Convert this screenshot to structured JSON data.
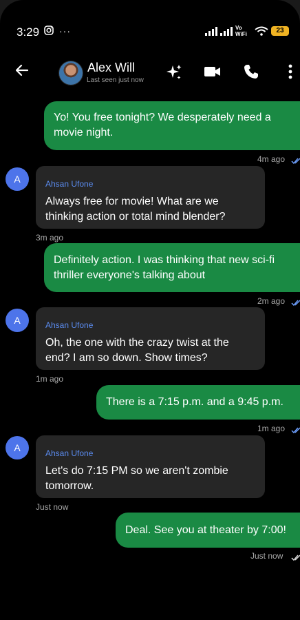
{
  "status_bar": {
    "time": "3:29",
    "network_label": "Vo\nWiFi",
    "battery": "23"
  },
  "header": {
    "contact_name": "Alex Will",
    "last_seen": "Last seen just now"
  },
  "messages": [
    {
      "direction": "outgoing",
      "text": "Yo! You free tonight? We desperately need a movie night.",
      "time": "4m ago"
    },
    {
      "direction": "incoming",
      "sender": "Ahsan Ufone",
      "avatar_letter": "A",
      "text": "Always free for movie! What are we thinking action or total mind blender?",
      "time": "3m ago"
    },
    {
      "direction": "outgoing",
      "text": "Definitely action. I was thinking that new sci-fi thriller everyone's talking about",
      "time": "2m ago"
    },
    {
      "direction": "incoming",
      "sender": "Ahsan Ufone",
      "avatar_letter": "A",
      "text": "Oh, the one with the crazy twist at the end? I am so down. Show times?",
      "time": "1m ago"
    },
    {
      "direction": "outgoing",
      "text": "There is a 7:15 p.m. and a 9:45 p.m.",
      "time": "1m ago"
    },
    {
      "direction": "incoming",
      "sender": "Ahsan Ufone",
      "avatar_letter": "A",
      "text": "Let's do 7:15 PM so we aren't  zombie tomorrow.",
      "time": "Just now"
    },
    {
      "direction": "outgoing",
      "text": "Deal. See you at theater by 7:00!",
      "time": "Just now"
    }
  ],
  "icons": [
    "back-arrow-icon",
    "sparkle-icon",
    "video-call-icon",
    "phone-call-icon",
    "more-vert-icon",
    "read-check-icon"
  ]
}
